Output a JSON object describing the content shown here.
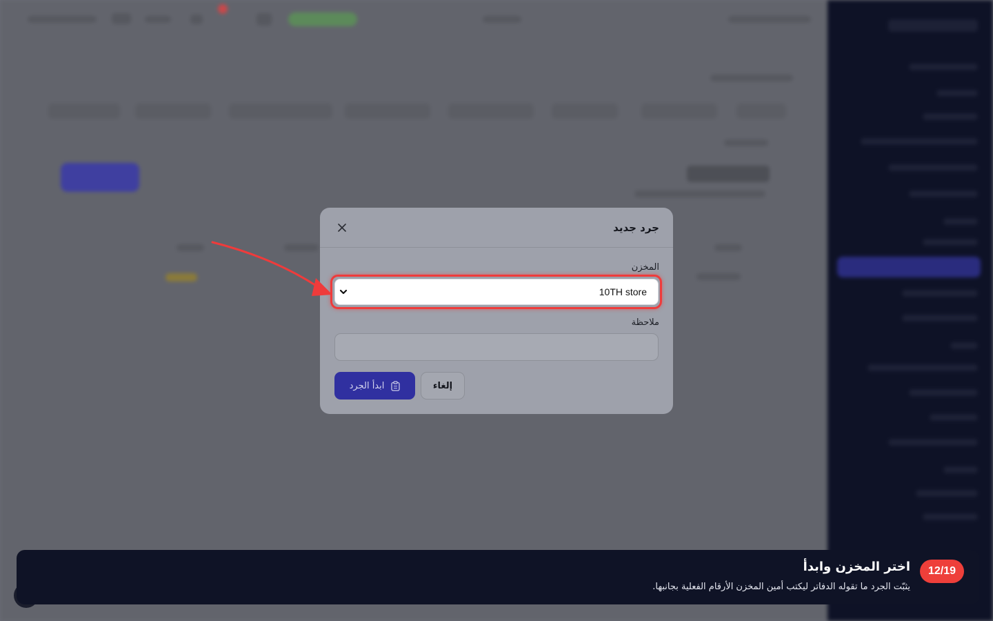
{
  "modal": {
    "title": "جرد جديد",
    "warehouse_label": "المخزن",
    "warehouse_value": "10TH store",
    "note_label": "ملاحظة",
    "note_value": "",
    "start_button": "ابدأ الجرد",
    "cancel_button": "إلغاء"
  },
  "tour": {
    "step": "12/19",
    "title": "اختر المخزن وابدأ",
    "description": "يثبّت الجرد ما تقوله الدفاتر ليكتب أمين المخزن الأرقام الفعلية بجانبها."
  },
  "colors": {
    "accent": "#3030a0",
    "highlight": "#ef3b3b",
    "tour_bg": "#0f1326",
    "badge": "#ee3f3a"
  }
}
